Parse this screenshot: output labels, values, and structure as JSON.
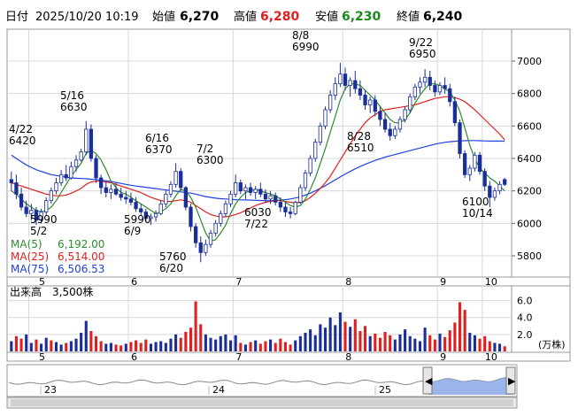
{
  "header": {
    "date_label": "日付",
    "datetime": "2025/10/20 10:19",
    "open_label": "始値",
    "open_value": "6,270",
    "high_label": "高値",
    "high_value": "6,280",
    "low_label": "安値",
    "low_value": "6,230",
    "close_label": "終値",
    "close_value": "6,240"
  },
  "legend": [
    {
      "label": "MA(5)",
      "value": "6,192.00",
      "color": "#2e8b2e"
    },
    {
      "label": "MA(25)",
      "value": "6,514.00",
      "color": "#e02020"
    },
    {
      "label": "MA(75)",
      "value": "6,506.53",
      "color": "#2040e0"
    }
  ],
  "volume_label": "出来高　3,500株",
  "volume_unit": "(万株)",
  "colors": {
    "up": "#1a2e9a",
    "down": "#1a2e9a",
    "volume_up": "#1a2e9a",
    "volume_down": "#e02020",
    "grid": "#d8d8d8",
    "navigator_fill": "#8aa8e8"
  },
  "chart_data": {
    "type": "candlestick",
    "x_axis_months": [
      "5",
      "6",
      "7",
      "8",
      "9",
      "10"
    ],
    "y_ticks": [
      5800,
      6000,
      6200,
      6400,
      6600,
      6800,
      7000
    ],
    "ylim": [
      5680,
      7180
    ],
    "volume_ticks": [
      "2.0",
      "4.0",
      "6.0"
    ],
    "volume_ylim": [
      0,
      7
    ],
    "navigator_years": [
      "23",
      "24",
      "25"
    ],
    "annotations": [
      {
        "date": "4/22",
        "price": "6420"
      },
      {
        "date": "5/2",
        "price": "5990"
      },
      {
        "date": "5/16",
        "price": "6630"
      },
      {
        "date": "6/9",
        "price": "5990"
      },
      {
        "date": "6/16",
        "price": "6370"
      },
      {
        "date": "6/20",
        "price": "5760"
      },
      {
        "date": "7/2",
        "price": "6300"
      },
      {
        "date": "7/22",
        "price": "6030"
      },
      {
        "date": "8/8",
        "price": "6990"
      },
      {
        "date": "8/28",
        "price": "6510"
      },
      {
        "date": "9/22",
        "price": "6950"
      },
      {
        "date": "10/14",
        "price": "6100"
      }
    ],
    "candles": [
      [
        6270,
        6320,
        6200,
        6250
      ],
      [
        6250,
        6300,
        6150,
        6180
      ],
      [
        6180,
        6220,
        6080,
        6100
      ],
      [
        6100,
        6140,
        6040,
        6060
      ],
      [
        6060,
        6120,
        6020,
        6080
      ],
      [
        6080,
        6100,
        5990,
        6020
      ],
      [
        6020,
        6090,
        6000,
        6070
      ],
      [
        6070,
        6160,
        6050,
        6140
      ],
      [
        6140,
        6220,
        6120,
        6200
      ],
      [
        6200,
        6280,
        6180,
        6250
      ],
      [
        6250,
        6330,
        6230,
        6300
      ],
      [
        6300,
        6360,
        6260,
        6280
      ],
      [
        6280,
        6380,
        6270,
        6350
      ],
      [
        6350,
        6420,
        6320,
        6390
      ],
      [
        6390,
        6460,
        6380,
        6440
      ],
      [
        6440,
        6630,
        6420,
        6580
      ],
      [
        6580,
        6610,
        6380,
        6400
      ],
      [
        6400,
        6420,
        6250,
        6280
      ],
      [
        6280,
        6300,
        6180,
        6220
      ],
      [
        6220,
        6260,
        6160,
        6190
      ],
      [
        6190,
        6240,
        6150,
        6210
      ],
      [
        6210,
        6250,
        6170,
        6180
      ],
      [
        6180,
        6220,
        6140,
        6160
      ],
      [
        6160,
        6200,
        6120,
        6150
      ],
      [
        6150,
        6190,
        6110,
        6130
      ],
      [
        6130,
        6160,
        6070,
        6090
      ],
      [
        6090,
        6120,
        6050,
        6070
      ],
      [
        6070,
        6090,
        6010,
        6030
      ],
      [
        6030,
        6060,
        5990,
        6040
      ],
      [
        6040,
        6080,
        6010,
        6060
      ],
      [
        6060,
        6140,
        6050,
        6120
      ],
      [
        6120,
        6200,
        6100,
        6180
      ],
      [
        6180,
        6260,
        6160,
        6240
      ],
      [
        6240,
        6370,
        6220,
        6320
      ],
      [
        6320,
        6340,
        6200,
        6220
      ],
      [
        6220,
        6230,
        6080,
        6100
      ],
      [
        6100,
        6120,
        5950,
        5980
      ],
      [
        5980,
        6000,
        5850,
        5880
      ],
      [
        5880,
        5920,
        5760,
        5820
      ],
      [
        5820,
        5900,
        5800,
        5870
      ],
      [
        5870,
        5960,
        5850,
        5940
      ],
      [
        5940,
        6020,
        5920,
        6000
      ],
      [
        6000,
        6080,
        5980,
        6060
      ],
      [
        6060,
        6140,
        6040,
        6120
      ],
      [
        6120,
        6200,
        6100,
        6180
      ],
      [
        6180,
        6300,
        6160,
        6250
      ],
      [
        6250,
        6270,
        6180,
        6200
      ],
      [
        6200,
        6240,
        6150,
        6220
      ],
      [
        6220,
        6250,
        6170,
        6190
      ],
      [
        6190,
        6230,
        6150,
        6210
      ],
      [
        6210,
        6250,
        6160,
        6180
      ],
      [
        6180,
        6210,
        6130,
        6150
      ],
      [
        6150,
        6200,
        6120,
        6170
      ],
      [
        6170,
        6190,
        6110,
        6130
      ],
      [
        6130,
        6160,
        6070,
        6100
      ],
      [
        6100,
        6130,
        6040,
        6070
      ],
      [
        6070,
        6100,
        6030,
        6060
      ],
      [
        6060,
        6140,
        6050,
        6130
      ],
      [
        6130,
        6240,
        6120,
        6220
      ],
      [
        6220,
        6330,
        6200,
        6310
      ],
      [
        6310,
        6420,
        6290,
        6400
      ],
      [
        6400,
        6520,
        6380,
        6500
      ],
      [
        6500,
        6620,
        6480,
        6600
      ],
      [
        6600,
        6720,
        6580,
        6700
      ],
      [
        6700,
        6820,
        6680,
        6790
      ],
      [
        6790,
        6900,
        6760,
        6860
      ],
      [
        6860,
        6990,
        6840,
        6920
      ],
      [
        6920,
        6960,
        6820,
        6850
      ],
      [
        6850,
        6900,
        6780,
        6880
      ],
      [
        6880,
        6940,
        6800,
        6830
      ],
      [
        6830,
        6880,
        6760,
        6790
      ],
      [
        6790,
        6820,
        6700,
        6730
      ],
      [
        6730,
        6780,
        6680,
        6760
      ],
      [
        6760,
        6790,
        6660,
        6690
      ],
      [
        6690,
        6720,
        6600,
        6640
      ],
      [
        6640,
        6680,
        6560,
        6580
      ],
      [
        6580,
        6620,
        6510,
        6540
      ],
      [
        6540,
        6600,
        6520,
        6580
      ],
      [
        6580,
        6660,
        6560,
        6640
      ],
      [
        6640,
        6720,
        6620,
        6700
      ],
      [
        6700,
        6800,
        6680,
        6780
      ],
      [
        6780,
        6860,
        6760,
        6840
      ],
      [
        6840,
        6900,
        6800,
        6870
      ],
      [
        6870,
        6950,
        6840,
        6900
      ],
      [
        6900,
        6940,
        6820,
        6850
      ],
      [
        6850,
        6880,
        6780,
        6810
      ],
      [
        6810,
        6870,
        6790,
        6850
      ],
      [
        6850,
        6900,
        6800,
        6830
      ],
      [
        6830,
        6860,
        6720,
        6750
      ],
      [
        6750,
        6780,
        6600,
        6620
      ],
      [
        6620,
        6640,
        6400,
        6430
      ],
      [
        6430,
        6450,
        6280,
        6300
      ],
      [
        6300,
        6360,
        6260,
        6340
      ],
      [
        6340,
        6440,
        6320,
        6420
      ],
      [
        6420,
        6440,
        6300,
        6320
      ],
      [
        6320,
        6340,
        6200,
        6230
      ],
      [
        6230,
        6260,
        6100,
        6160
      ],
      [
        6160,
        6220,
        6140,
        6200
      ],
      [
        6200,
        6260,
        6180,
        6240
      ],
      [
        6270,
        6280,
        6230,
        6240
      ]
    ],
    "volumes": [
      [
        1.2,
        1
      ],
      [
        1.8,
        0
      ],
      [
        1.5,
        0
      ],
      [
        2.0,
        1
      ],
      [
        1.0,
        1
      ],
      [
        1.4,
        0
      ],
      [
        0.9,
        1
      ],
      [
        1.6,
        1
      ],
      [
        1.3,
        0
      ],
      [
        1.1,
        1
      ],
      [
        0.8,
        1
      ],
      [
        1.0,
        0
      ],
      [
        1.2,
        1
      ],
      [
        1.5,
        1
      ],
      [
        2.2,
        1
      ],
      [
        3.6,
        1
      ],
      [
        2.4,
        0
      ],
      [
        1.8,
        0
      ],
      [
        1.2,
        0
      ],
      [
        0.9,
        1
      ],
      [
        1.0,
        1
      ],
      [
        0.8,
        0
      ],
      [
        0.7,
        0
      ],
      [
        0.9,
        1
      ],
      [
        1.1,
        0
      ],
      [
        1.3,
        0
      ],
      [
        1.0,
        0
      ],
      [
        1.4,
        0
      ],
      [
        0.9,
        1
      ],
      [
        1.1,
        1
      ],
      [
        1.2,
        1
      ],
      [
        1.0,
        1
      ],
      [
        1.5,
        1
      ],
      [
        2.0,
        1
      ],
      [
        1.6,
        0
      ],
      [
        2.3,
        0
      ],
      [
        2.8,
        0
      ],
      [
        5.9,
        0
      ],
      [
        3.2,
        0
      ],
      [
        2.0,
        1
      ],
      [
        1.6,
        1
      ],
      [
        1.4,
        1
      ],
      [
        1.8,
        1
      ],
      [
        2.0,
        1
      ],
      [
        1.3,
        1
      ],
      [
        1.9,
        1
      ],
      [
        1.0,
        0
      ],
      [
        0.8,
        1
      ],
      [
        1.1,
        0
      ],
      [
        1.3,
        1
      ],
      [
        0.9,
        0
      ],
      [
        1.2,
        0
      ],
      [
        1.4,
        1
      ],
      [
        1.0,
        0
      ],
      [
        1.5,
        0
      ],
      [
        1.1,
        0
      ],
      [
        0.8,
        0
      ],
      [
        1.3,
        1
      ],
      [
        1.8,
        1
      ],
      [
        2.2,
        1
      ],
      [
        2.6,
        1
      ],
      [
        1.9,
        1
      ],
      [
        3.2,
        1
      ],
      [
        2.8,
        1
      ],
      [
        4.0,
        1
      ],
      [
        3.1,
        1
      ],
      [
        4.6,
        1
      ],
      [
        3.5,
        0
      ],
      [
        2.9,
        1
      ],
      [
        3.8,
        0
      ],
      [
        2.4,
        0
      ],
      [
        3.0,
        0
      ],
      [
        1.8,
        1
      ],
      [
        2.1,
        0
      ],
      [
        1.6,
        0
      ],
      [
        2.3,
        0
      ],
      [
        1.9,
        0
      ],
      [
        1.4,
        1
      ],
      [
        2.0,
        1
      ],
      [
        2.6,
        1
      ],
      [
        1.8,
        1
      ],
      [
        1.5,
        1
      ],
      [
        1.2,
        1
      ],
      [
        2.8,
        1
      ],
      [
        1.9,
        0
      ],
      [
        1.4,
        0
      ],
      [
        2.1,
        1
      ],
      [
        1.7,
        0
      ],
      [
        2.5,
        0
      ],
      [
        3.4,
        0
      ],
      [
        5.8,
        0
      ],
      [
        4.9,
        0
      ],
      [
        2.2,
        1
      ],
      [
        1.9,
        1
      ],
      [
        1.5,
        0
      ],
      [
        1.8,
        0
      ],
      [
        1.2,
        0
      ],
      [
        1.0,
        1
      ],
      [
        0.9,
        1
      ],
      [
        0.6,
        0
      ]
    ],
    "ma5": [
      6200,
      6180,
      6150,
      6120,
      6100,
      6080,
      6070,
      6080,
      6100,
      6140,
      6190,
      6240,
      6290,
      6330,
      6370,
      6430,
      6450,
      6430,
      6390,
      6330,
      6260,
      6220,
      6190,
      6180,
      6160,
      6140,
      6120,
      6100,
      6080,
      6060,
      6070,
      6090,
      6120,
      6170,
      6210,
      6200,
      6160,
      6100,
      6020,
      5940,
      5890,
      5900,
      5940,
      5990,
      6060,
      6120,
      6160,
      6190,
      6200,
      6210,
      6200,
      6190,
      6180,
      6170,
      6150,
      6130,
      6110,
      6100,
      6110,
      6150,
      6210,
      6280,
      6370,
      6460,
      6560,
      6660,
      6760,
      6830,
      6860,
      6860,
      6850,
      6820,
      6790,
      6760,
      6720,
      6680,
      6640,
      6620,
      6620,
      6640,
      6680,
      6740,
      6790,
      6830,
      6860,
      6860,
      6850,
      6830,
      6810,
      6760,
      6690,
      6590,
      6480,
      6400,
      6340,
      6310,
      6280,
      6260,
      6230,
      6200
    ],
    "ma25": [
      6250,
      6240,
      6230,
      6220,
      6210,
      6200,
      6190,
      6180,
      6175,
      6170,
      6170,
      6175,
      6185,
      6200,
      6215,
      6240,
      6255,
      6260,
      6260,
      6255,
      6250,
      6240,
      6230,
      6220,
      6210,
      6200,
      6190,
      6175,
      6160,
      6150,
      6140,
      6135,
      6135,
      6140,
      6145,
      6140,
      6130,
      6110,
      6090,
      6070,
      6055,
      6045,
      6040,
      6040,
      6045,
      6055,
      6065,
      6080,
      6095,
      6110,
      6120,
      6130,
      6135,
      6140,
      6140,
      6135,
      6130,
      6125,
      6130,
      6140,
      6160,
      6185,
      6215,
      6250,
      6290,
      6340,
      6390,
      6440,
      6490,
      6540,
      6580,
      6620,
      6650,
      6670,
      6690,
      6700,
      6705,
      6710,
      6715,
      6720,
      6725,
      6730,
      6740,
      6750,
      6760,
      6770,
      6775,
      6780,
      6780,
      6775,
      6765,
      6750,
      6725,
      6700,
      6670,
      6640,
      6610,
      6580,
      6550,
      6514
    ],
    "ma75": [
      6420,
      6400,
      6380,
      6360,
      6345,
      6330,
      6320,
      6310,
      6300,
      6295,
      6290,
      6285,
      6280,
      6278,
      6276,
      6275,
      6272,
      6270,
      6266,
      6262,
      6258,
      6252,
      6246,
      6240,
      6235,
      6230,
      6226,
      6222,
      6218,
      6214,
      6210,
      6206,
      6202,
      6198,
      6194,
      6190,
      6186,
      6180,
      6172,
      6165,
      6160,
      6155,
      6152,
      6150,
      6148,
      6146,
      6145,
      6144,
      6143,
      6142,
      6141,
      6140,
      6140,
      6141,
      6143,
      6146,
      6150,
      6156,
      6164,
      6174,
      6186,
      6200,
      6216,
      6232,
      6250,
      6268,
      6286,
      6304,
      6320,
      6336,
      6350,
      6364,
      6376,
      6388,
      6398,
      6408,
      6416,
      6424,
      6432,
      6440,
      6448,
      6456,
      6464,
      6472,
      6480,
      6488,
      6494,
      6499,
      6503,
      6506,
      6508,
      6509,
      6510,
      6510,
      6509,
      6508,
      6507,
      6507,
      6507,
      6506.53
    ]
  }
}
